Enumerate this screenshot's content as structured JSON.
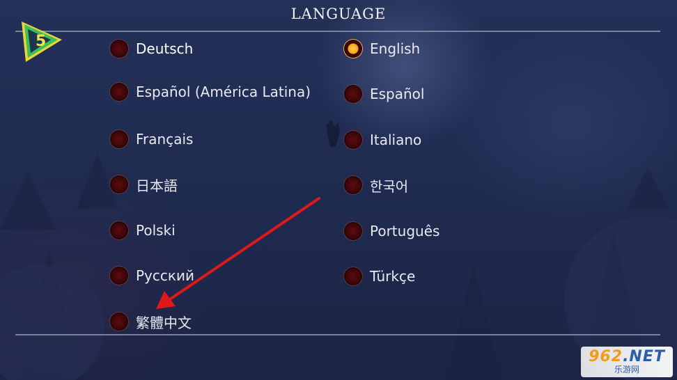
{
  "screen": {
    "title": "LANGUAGE",
    "badge_number": "5"
  },
  "languages": {
    "left": [
      {
        "label": "Deutsch",
        "selected": false,
        "focused": true
      },
      {
        "label": "Español (América Latina)",
        "selected": false,
        "focused": false
      },
      {
        "label": "Français",
        "selected": false,
        "focused": false
      },
      {
        "label": "日本語",
        "selected": false,
        "focused": false
      },
      {
        "label": "Polski",
        "selected": false,
        "focused": false
      },
      {
        "label": "Русский",
        "selected": false,
        "focused": false
      },
      {
        "label": "繁體中文",
        "selected": false,
        "focused": false
      }
    ],
    "right": [
      {
        "label": "English",
        "selected": true,
        "focused": false
      },
      {
        "label": "Español",
        "selected": false,
        "focused": false
      },
      {
        "label": "Italiano",
        "selected": false,
        "focused": false
      },
      {
        "label": "한국어",
        "selected": false,
        "focused": false
      },
      {
        "label": "Português",
        "selected": false,
        "focused": false
      },
      {
        "label": "Türkçe",
        "selected": false,
        "focused": false
      }
    ]
  },
  "watermark": {
    "main": "962",
    "suffix": ".NET",
    "sub": "乐游网"
  },
  "colors": {
    "background": "#1f2a4f",
    "focus_highlight": "#2b84c4",
    "radio_selected": "#f4a41c",
    "radio_unselected": "#3b0507",
    "annotation_arrow": "#e01818",
    "badge_green": "#3fbf5a",
    "badge_yellow": "#e8d63a"
  }
}
